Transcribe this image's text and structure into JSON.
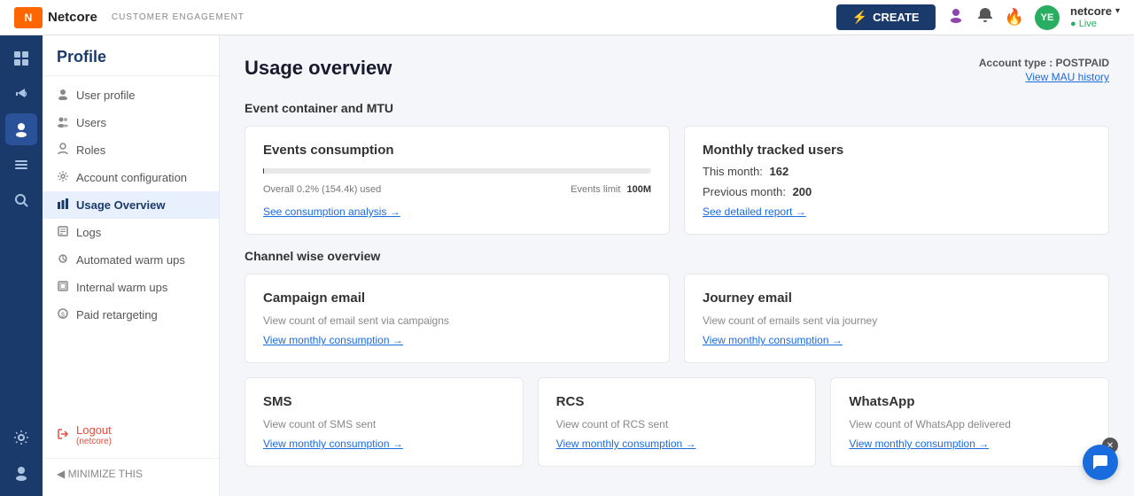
{
  "topnav": {
    "logo_icon": "N",
    "logo_text": "Netcore",
    "badge": "CUSTOMER ENGAGEMENT",
    "create_label": "CREATE",
    "create_icon": "⚡",
    "user_avatar": "👤",
    "bell_icon": "🔔",
    "fire_icon": "🔥",
    "status_avatar": "YE",
    "status_name": "netcore",
    "status_live": "● Live",
    "dropdown_icon": "▾"
  },
  "icon_sidebar": {
    "items": [
      {
        "icon": "⊞",
        "name": "grid-icon",
        "active": false
      },
      {
        "icon": "📢",
        "name": "megaphone-icon",
        "active": false
      },
      {
        "icon": "👤",
        "name": "user-icon",
        "active": true
      },
      {
        "icon": "📋",
        "name": "list-icon",
        "active": false
      },
      {
        "icon": "🔍",
        "name": "search-icon",
        "active": false
      }
    ],
    "bottom_items": [
      {
        "icon": "⚙",
        "name": "settings-icon"
      },
      {
        "icon": "👤",
        "name": "profile-icon"
      }
    ]
  },
  "sidebar": {
    "title": "Profile",
    "items": [
      {
        "icon": "👤",
        "label": "User profile",
        "active": false,
        "name": "user-profile"
      },
      {
        "icon": "👥",
        "label": "Users",
        "active": false,
        "name": "users"
      },
      {
        "icon": "🔑",
        "label": "Roles",
        "active": false,
        "name": "roles"
      },
      {
        "icon": "⚙",
        "label": "Account configuration",
        "active": false,
        "name": "account-config"
      },
      {
        "icon": "📊",
        "label": "Usage Overview",
        "active": true,
        "name": "usage-overview"
      },
      {
        "icon": "📋",
        "label": "Logs",
        "active": false,
        "name": "logs"
      },
      {
        "icon": "🌡",
        "label": "Automated warm ups",
        "active": false,
        "name": "automated-warm-ups"
      },
      {
        "icon": "🌡",
        "label": "Internal warm ups",
        "active": false,
        "name": "internal-warm-ups"
      },
      {
        "icon": "💰",
        "label": "Paid retargeting",
        "active": false,
        "name": "paid-retargeting"
      }
    ],
    "logout": {
      "label": "Logout",
      "sub_label": "(netcore)",
      "icon": "⏻",
      "name": "logout"
    },
    "minimize_label": "◀ MINIMIZE THIS"
  },
  "main": {
    "page_title": "Usage overview",
    "account_type_label": "Account type : POSTPAID",
    "view_mau_label": "View MAU history",
    "section1_title": "Event container and MTU",
    "section2_title": "Channel wise overview",
    "events_card": {
      "title": "Events consumption",
      "progress_percent": 0.2,
      "progress_fill_width": "0.2",
      "overall_label": "Overall 0.2% (154.4k) used",
      "limit_label": "Events limit",
      "limit_value": "100M",
      "link_label": "See consumption analysis →"
    },
    "mtu_card": {
      "title": "Monthly tracked users",
      "this_month_label": "This month:",
      "this_month_value": "162",
      "prev_month_label": "Previous month:",
      "prev_month_value": "200",
      "link_label": "See detailed report →"
    },
    "channel_cards": [
      {
        "title": "Campaign email",
        "desc": "View count of email sent via campaigns",
        "link": "View monthly consumption →",
        "name": "campaign-email"
      },
      {
        "title": "Journey email",
        "desc": "View count of emails sent via journey",
        "link": "View monthly consumption →",
        "name": "journey-email"
      },
      {
        "title": "SMS",
        "desc": "View count of SMS sent",
        "link": "View monthly consumption →",
        "name": "sms"
      },
      {
        "title": "RCS",
        "desc": "View count of RCS sent",
        "link": "View monthly consumption →",
        "name": "rcs"
      },
      {
        "title": "WhatsApp",
        "desc": "View count of WhatsApp delivered",
        "link": "View monthly consumption →",
        "name": "whatsapp"
      }
    ]
  }
}
